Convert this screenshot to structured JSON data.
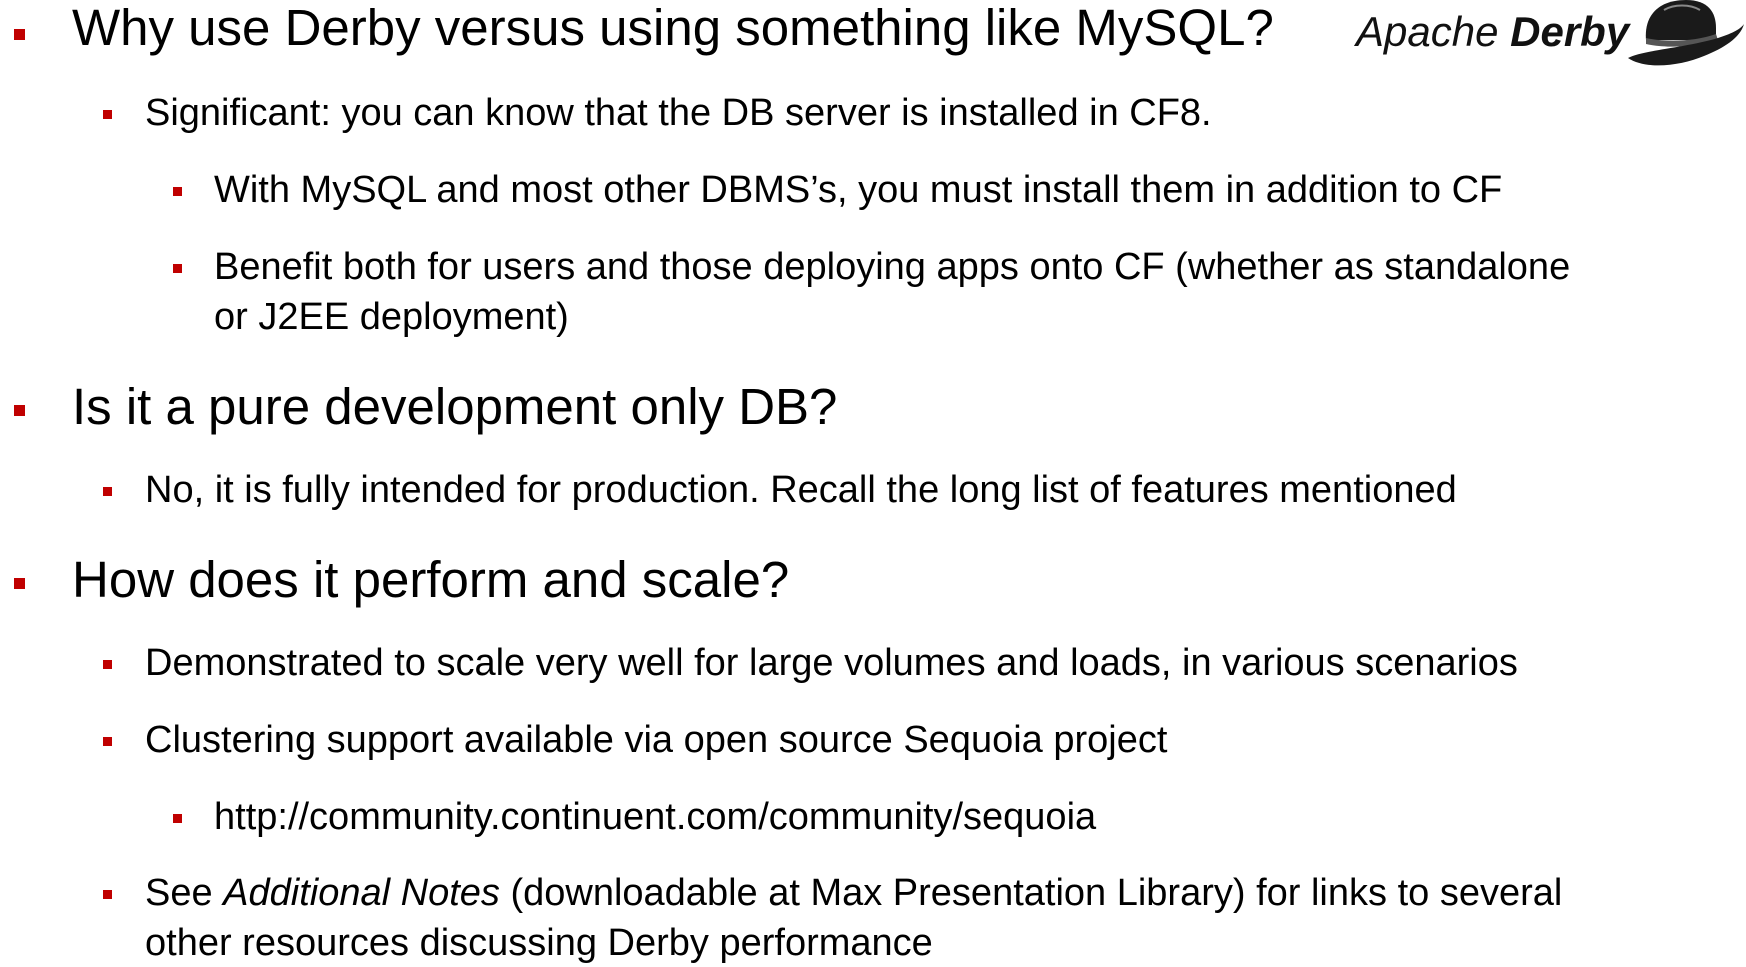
{
  "colors": {
    "bullet": "#c00000",
    "text": "#000000"
  },
  "logo": {
    "word_apache": "Apache",
    "word_derby": "Derby",
    "icon": "derby-hat-icon"
  },
  "items": [
    {
      "level": 1,
      "text": "Why use Derby versus using something like MySQL?"
    },
    {
      "level": 2,
      "text": "Significant: you can know that the DB server is installed in CF8."
    },
    {
      "level": 3,
      "text": "With MySQL and most other DBMS’s, you must install them in addition to CF"
    },
    {
      "level": 3,
      "text": "Benefit both for users and those deploying apps onto CF (whether as standalone",
      "text_cont": "or J2EE deployment)"
    },
    {
      "level": 1,
      "text": "Is it a pure development only DB?"
    },
    {
      "level": 2,
      "text": "No, it is fully intended for production. Recall the long list of features mentioned"
    },
    {
      "level": 1,
      "text": "How does it perform and scale?"
    },
    {
      "level": 2,
      "text": "Demonstrated to scale very well for large volumes and loads, in various scenarios"
    },
    {
      "level": 2,
      "text": "Clustering support available via open source Sequoia project"
    },
    {
      "level": 3,
      "text": "http://community.continuent.com/community/sequoia"
    },
    {
      "level": 2,
      "text_pre": "See ",
      "text_italic": "Additional Notes",
      "text_post": " (downloadable at Max Presentation Library) for links to several",
      "text_cont": "other resources discussing Derby performance"
    }
  ]
}
